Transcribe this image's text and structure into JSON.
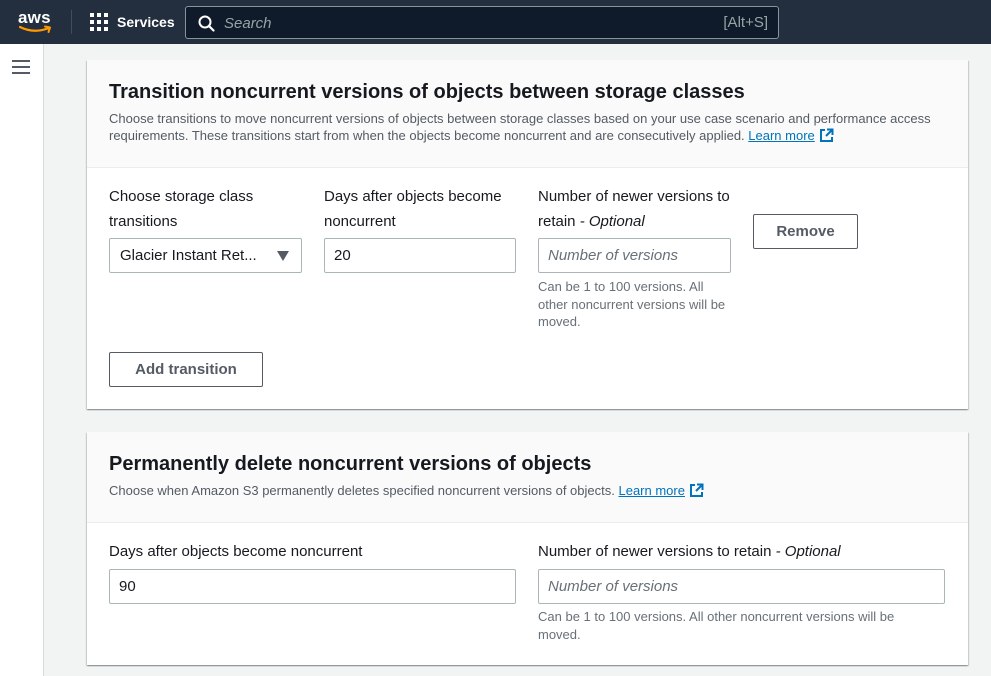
{
  "topnav": {
    "logo_text": "aws",
    "services_label": "Services",
    "search_placeholder": "Search",
    "search_shortcut": "[Alt+S]"
  },
  "transition_panel": {
    "title": "Transition noncurrent versions of objects between storage classes",
    "description": "Choose transitions to move noncurrent versions of objects between storage classes based on your use case scenario and performance access requirements. These transitions start from when the objects become noncurrent and are consecutively applied.",
    "learn_more": "Learn more",
    "storage_class_label": "Choose storage class transitions",
    "storage_class_value": "Glacier Instant Ret...",
    "days_label": "Days after objects become noncurrent",
    "days_value": "20",
    "newer_versions_label": "Number of newer versions to retain",
    "optional_suffix": "- Optional",
    "newer_versions_placeholder": "Number of versions",
    "newer_versions_hint": "Can be 1 to 100 versions. All other noncurrent versions will be moved.",
    "remove_button": "Remove",
    "add_transition_button": "Add transition"
  },
  "delete_panel": {
    "title": "Permanently delete noncurrent versions of objects",
    "description": "Choose when Amazon S3 permanently deletes specified noncurrent versions of objects.",
    "learn_more": "Learn more",
    "days_label": "Days after objects become noncurrent",
    "days_value": "90",
    "newer_versions_label": "Number of newer versions to retain",
    "optional_suffix": "- Optional",
    "newer_versions_placeholder": "Number of versions",
    "newer_versions_hint": "Can be 1 to 100 versions. All other noncurrent versions will be moved."
  },
  "colors": {
    "nav_bg": "#232f3e",
    "link": "#0073bb",
    "accent_orange": "#ff9900"
  }
}
